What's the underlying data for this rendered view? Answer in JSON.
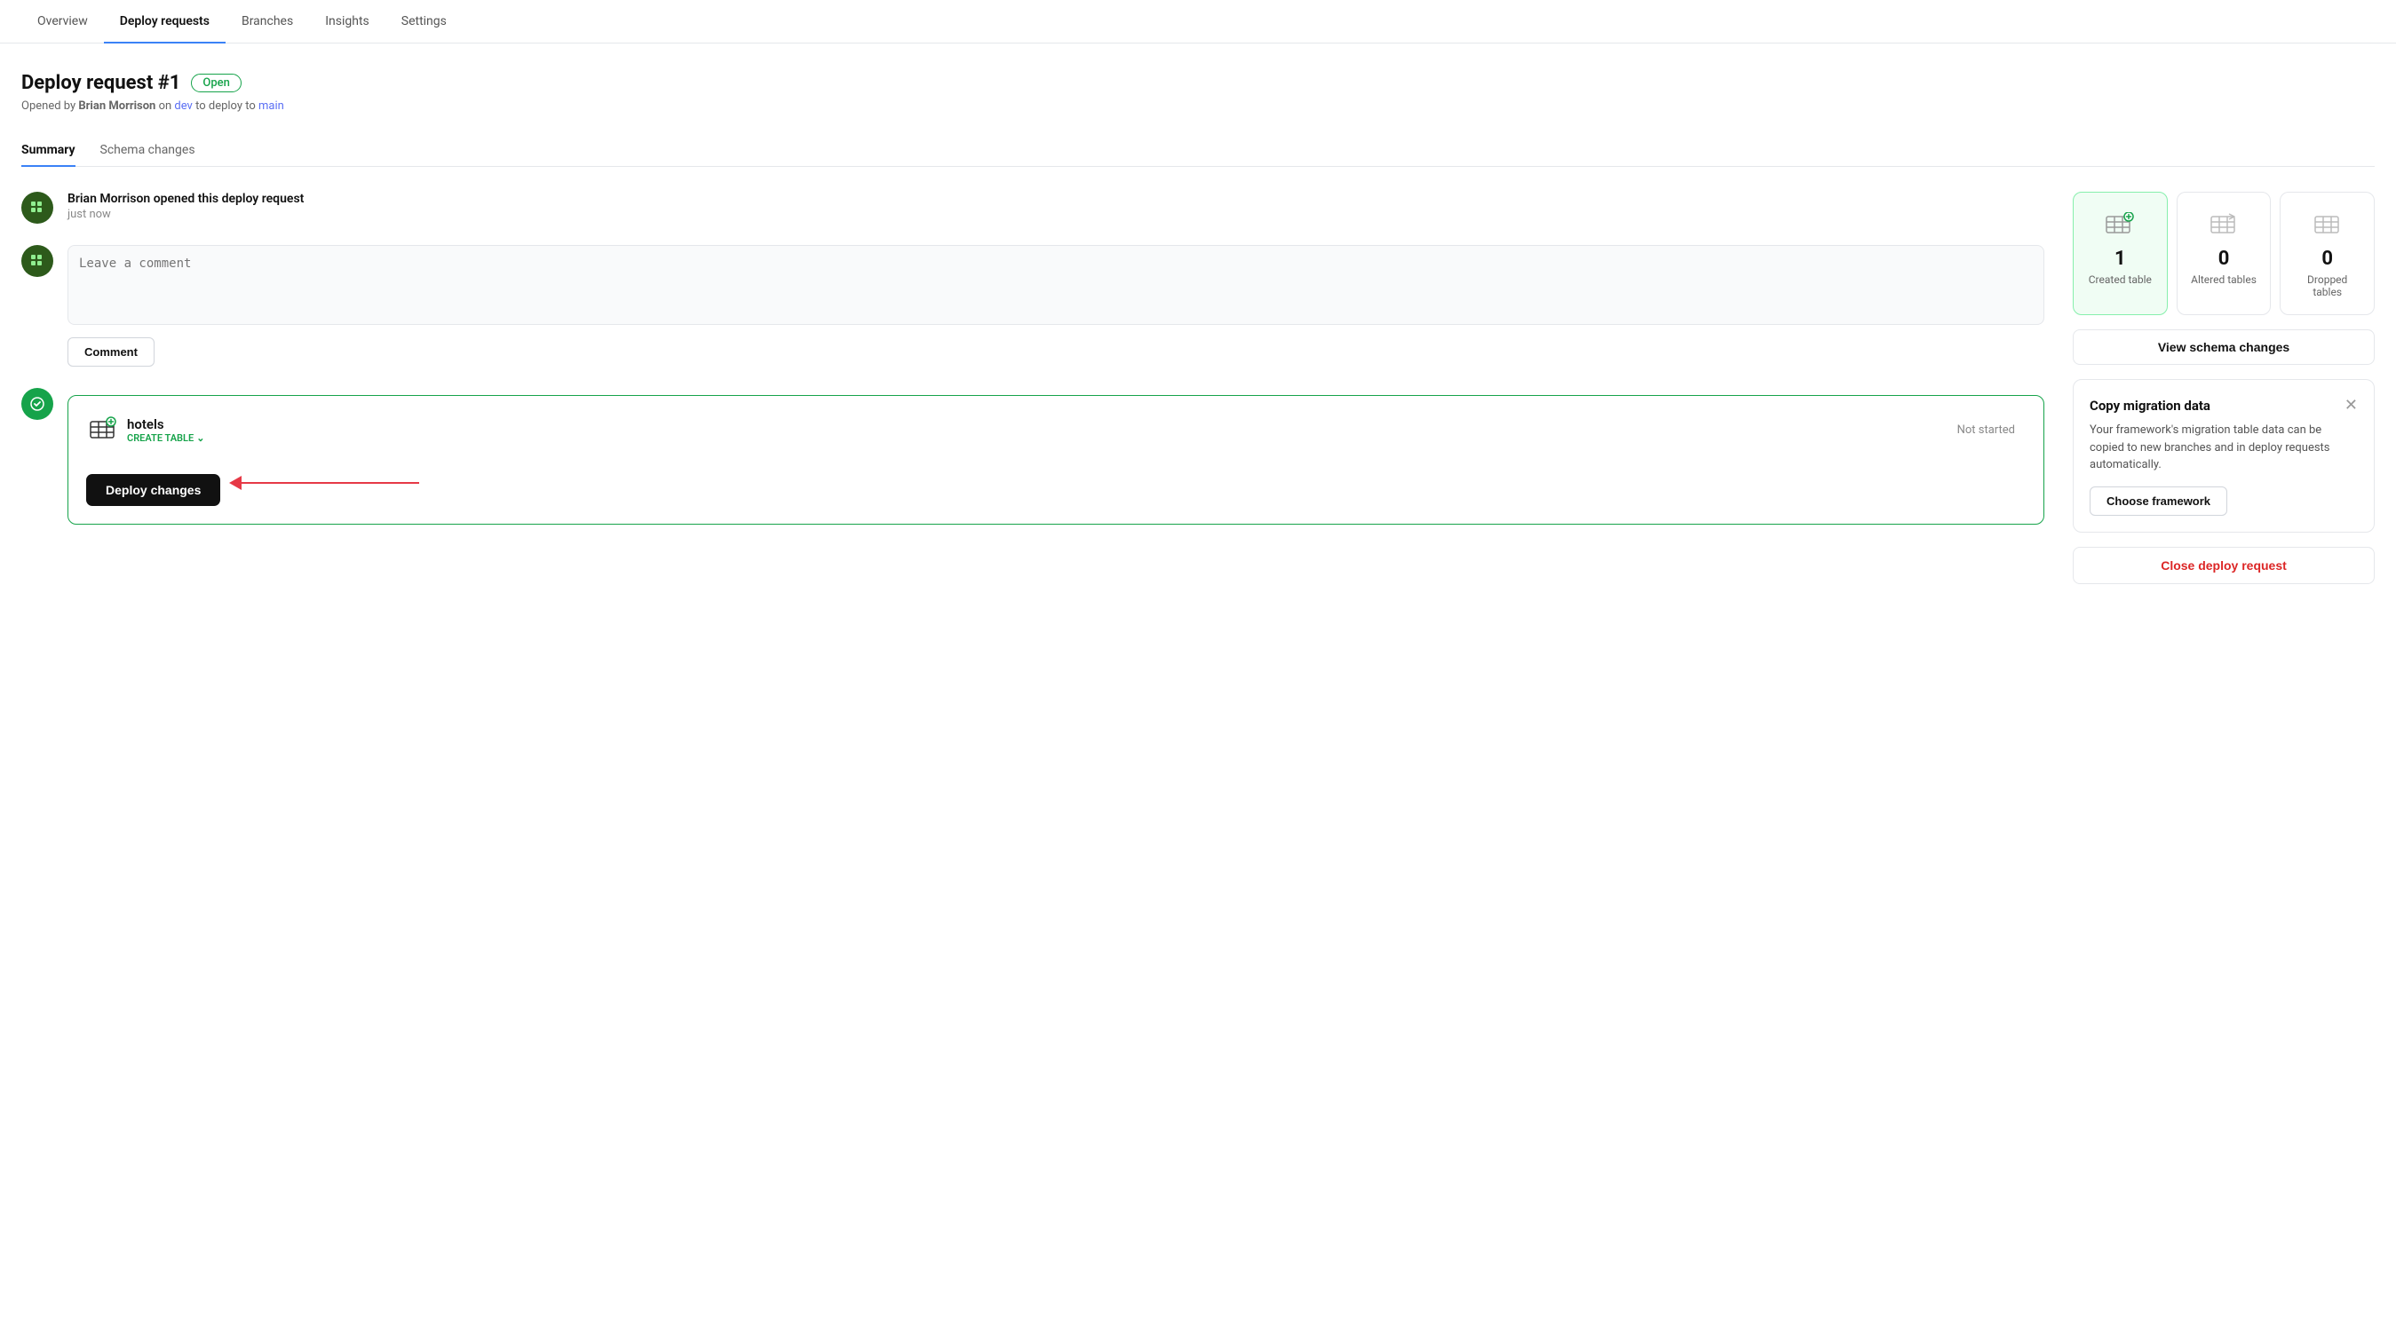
{
  "nav": {
    "items": [
      {
        "label": "Overview",
        "active": false
      },
      {
        "label": "Deploy requests",
        "active": true
      },
      {
        "label": "Branches",
        "active": false
      },
      {
        "label": "Insights",
        "active": false
      },
      {
        "label": "Settings",
        "active": false
      }
    ]
  },
  "header": {
    "title": "Deploy request #1",
    "badge": "Open",
    "subtitle_prefix": "Opened by ",
    "author": "Brian Morrison",
    "subtitle_mid": " on ",
    "branch_from": "dev",
    "subtitle_to": " to deploy to ",
    "branch_to": "main"
  },
  "sub_tabs": [
    {
      "label": "Summary",
      "active": true
    },
    {
      "label": "Schema changes",
      "active": false
    }
  ],
  "timeline": {
    "event_text": "Brian Morrison opened this deploy request",
    "event_time": "just now",
    "comment_placeholder": "Leave a comment",
    "comment_btn": "Comment"
  },
  "deploy_card": {
    "table_name": "hotels",
    "action_label": "CREATE TABLE",
    "status": "Not started",
    "deploy_btn": "Deploy changes"
  },
  "stats": {
    "created": {
      "count": 1,
      "label": "Created table",
      "active": true
    },
    "altered": {
      "count": 0,
      "label": "Altered tables",
      "active": false
    },
    "dropped": {
      "count": 0,
      "label": "Dropped tables",
      "active": false
    }
  },
  "view_schema_btn": "View schema changes",
  "migration_card": {
    "title": "Copy migration data",
    "text": "Your framework's migration table data can be copied to new branches and in deploy requests automatically.",
    "choose_btn": "Choose framework"
  },
  "close_deploy_btn": "Close deploy request"
}
